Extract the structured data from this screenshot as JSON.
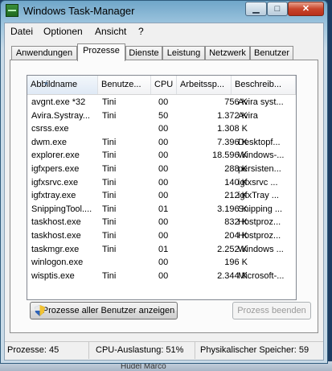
{
  "window": {
    "title": "Windows Task-Manager"
  },
  "menu": [
    "Datei",
    "Optionen",
    "Ansicht",
    "?"
  ],
  "tabs": [
    "Anwendungen",
    "Prozesse",
    "Dienste",
    "Leistung",
    "Netzwerk",
    "Benutzer"
  ],
  "active_tab": "Prozesse",
  "table": {
    "columns": [
      "Abbildname",
      "Benutze...",
      "CPU",
      "Arbeitssp...",
      "Beschreib..."
    ],
    "rows": [
      [
        "avgnt.exe *32",
        "Tini",
        "00",
        "756 K",
        "Avira syst..."
      ],
      [
        "Avira.Systray...",
        "Tini",
        "50",
        "1.372 K",
        "Avira"
      ],
      [
        "csrss.exe",
        "",
        "00",
        "1.308 K",
        ""
      ],
      [
        "dwm.exe",
        "Tini",
        "00",
        "7.396 K",
        "Desktopf..."
      ],
      [
        "explorer.exe",
        "Tini",
        "00",
        "18.596 K",
        "Windows-..."
      ],
      [
        "igfxpers.exe",
        "Tini",
        "00",
        "288 K",
        "persisten..."
      ],
      [
        "igfxsrvc.exe",
        "Tini",
        "00",
        "140 K",
        "igfxsrvc ..."
      ],
      [
        "igfxtray.exe",
        "Tini",
        "00",
        "212 K",
        "igfxTray ..."
      ],
      [
        "SnippingTool....",
        "Tini",
        "01",
        "3.196 K",
        "Snipping ..."
      ],
      [
        "taskhost.exe",
        "Tini",
        "00",
        "832 K",
        "Hostproz..."
      ],
      [
        "taskhost.exe",
        "Tini",
        "00",
        "204 K",
        "Hostproz..."
      ],
      [
        "taskmgr.exe",
        "Tini",
        "01",
        "2.252 K",
        "Windows ..."
      ],
      [
        "winlogon.exe",
        "",
        "00",
        "196 K",
        ""
      ],
      [
        "wisptis.exe",
        "Tini",
        "00",
        "2.344 K",
        "Microsoft-..."
      ]
    ]
  },
  "buttons": {
    "show_all": "Prozesse aller Benutzer anzeigen",
    "end_process": "Prozess beenden"
  },
  "status": {
    "processes": "Prozesse: 45",
    "cpu": "CPU-Auslastung: 51%",
    "memory": "Physikalischer Speicher: 59"
  },
  "background_text": "Hudel Marco"
}
